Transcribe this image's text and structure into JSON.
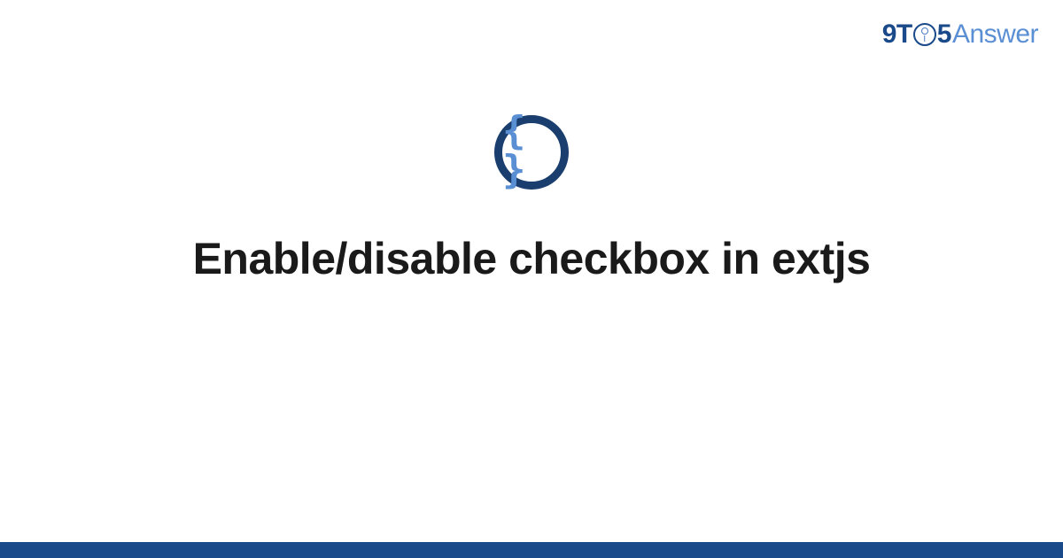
{
  "logo": {
    "part1": "9T",
    "part2": "5",
    "part3": "Answer"
  },
  "icon": {
    "braces": "{ }"
  },
  "title": "Enable/disable checkbox in extjs",
  "colors": {
    "primary_dark": "#1a4a8a",
    "primary_light": "#5a8fd4",
    "icon_border": "#1a3e6e"
  }
}
